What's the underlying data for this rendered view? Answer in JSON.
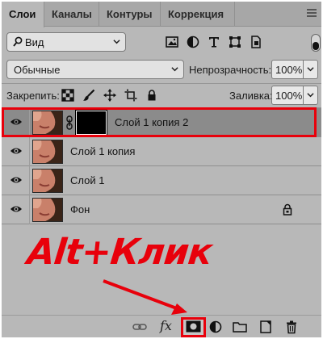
{
  "tabs": [
    {
      "label": "Слои",
      "active": true
    },
    {
      "label": "Каналы",
      "active": false
    },
    {
      "label": "Контуры",
      "active": false
    },
    {
      "label": "Коррекция",
      "active": false
    }
  ],
  "filter": {
    "kind_label": "Вид"
  },
  "blend": {
    "mode": "Обычные",
    "opacity_label": "Непрозрачность:",
    "opacity_value": "100%"
  },
  "lock": {
    "label": "Закрепить:",
    "fill_label": "Заливка:",
    "fill_value": "100%"
  },
  "layers": [
    {
      "name": "Слой 1 копия 2",
      "selected": true,
      "has_mask": true,
      "locked": false
    },
    {
      "name": "Слой 1 копия",
      "selected": false,
      "has_mask": false,
      "locked": false
    },
    {
      "name": "Слой 1",
      "selected": false,
      "has_mask": false,
      "locked": false
    },
    {
      "name": "Фон",
      "selected": false,
      "has_mask": false,
      "locked": true
    }
  ],
  "annotation": {
    "text": "Alt+Клик",
    "color": "#e8000b"
  },
  "bottom_toolbar": {
    "fx_label": "fx"
  },
  "colors": {
    "panel": "#b8b8b8",
    "selected_row": "#8b8b8b",
    "highlight": "#e8000b"
  }
}
